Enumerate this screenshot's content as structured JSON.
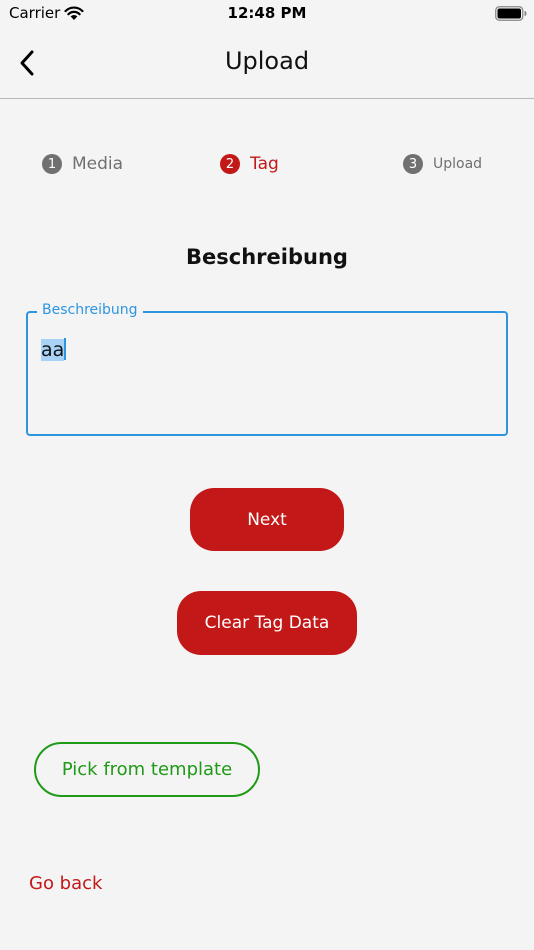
{
  "status_bar": {
    "carrier": "Carrier",
    "time": "12:48 PM"
  },
  "nav": {
    "title": "Upload",
    "back_icon": "chevron-left-icon"
  },
  "stepper": {
    "steps": [
      {
        "number": "1",
        "label": "Media",
        "state": "inactive",
        "color": "#707070"
      },
      {
        "number": "2",
        "label": "Tag",
        "state": "active",
        "color": "#c31818"
      },
      {
        "number": "3",
        "label": "Upload",
        "state": "inactive",
        "color": "#707070"
      }
    ]
  },
  "section": {
    "heading": "Beschreibung"
  },
  "description_field": {
    "label": "Beschreibung",
    "value": "aa",
    "focused": true,
    "accent_color": "#2d95e0"
  },
  "buttons": {
    "next": "Next",
    "clear": "Clear Tag Data",
    "pick_template": "Pick from template",
    "go_back": "Go back"
  },
  "colors": {
    "primary": "#c31818",
    "success": "#1f9a16",
    "background": "#f4f4f4"
  }
}
